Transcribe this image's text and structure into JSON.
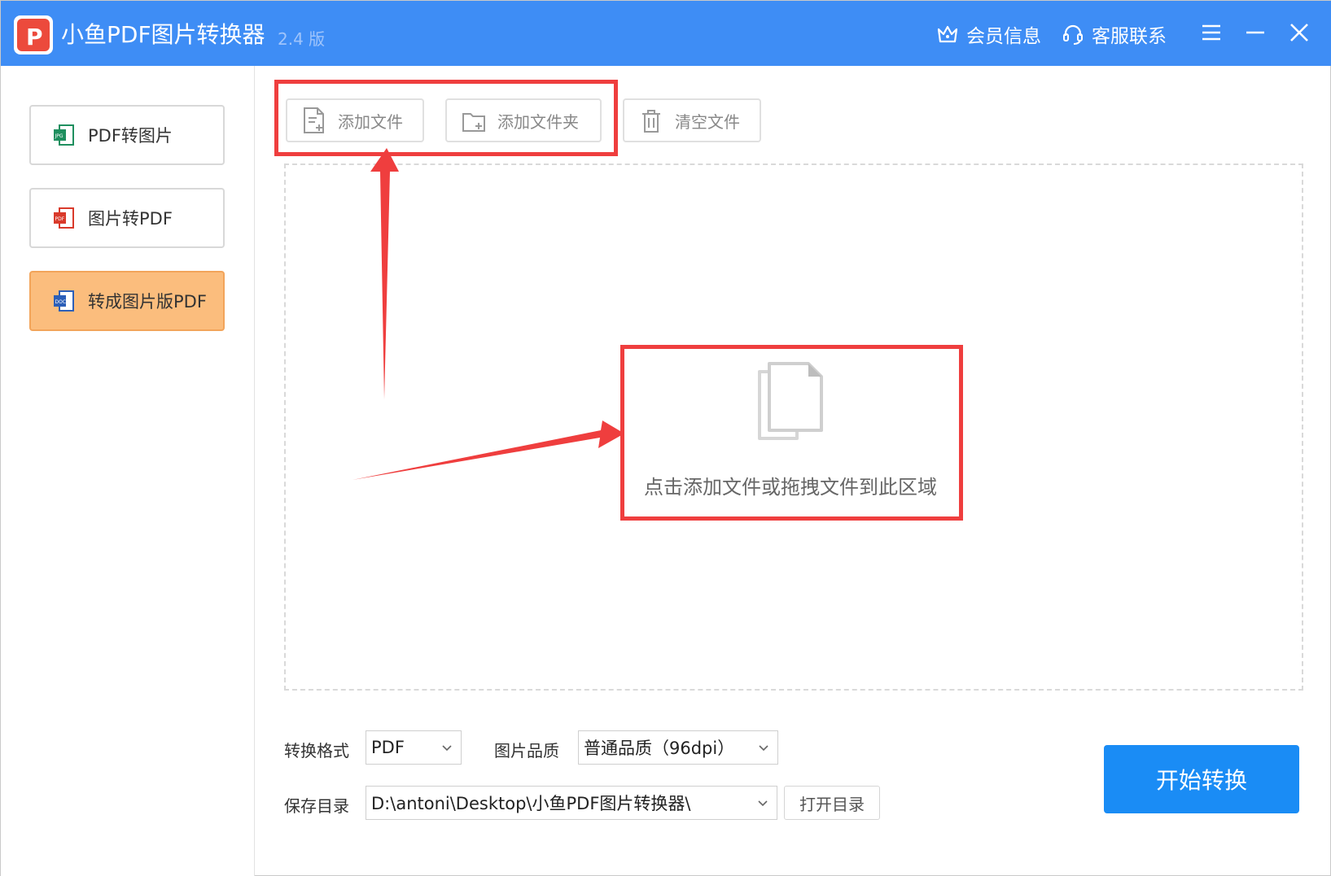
{
  "titlebar": {
    "app_name": "小鱼PDF图片转换器",
    "version": "2.4 版",
    "member_label": "会员信息",
    "service_label": "客服联系"
  },
  "sidebar": {
    "items": [
      {
        "label": "PDF转图片",
        "icon": "jpg-file-icon",
        "active": false
      },
      {
        "label": "图片转PDF",
        "icon": "pdf-file-icon",
        "active": false
      },
      {
        "label": "转成图片版PDF",
        "icon": "doc-file-icon",
        "active": true
      }
    ]
  },
  "toolbar": {
    "add_file_label": "添加文件",
    "add_folder_label": "添加文件夹",
    "clear_label": "清空文件"
  },
  "dropzone": {
    "hint": "点击添加文件或拖拽文件到此区域"
  },
  "settings": {
    "format_label": "转换格式",
    "format_value": "PDF",
    "quality_label": "图片品质",
    "quality_value": "普通品质（96dpi）",
    "dir_label": "保存目录",
    "dir_value": "D:\\antoni\\Desktop\\小鱼PDF图片转换器\\",
    "open_dir_label": "打开目录",
    "start_label": "开始转换"
  },
  "colors": {
    "titlebar": "#3e8df5",
    "active_nav": "#fbbd7d",
    "start_button": "#1a8cf5",
    "annotation": "#ef3e3e"
  }
}
